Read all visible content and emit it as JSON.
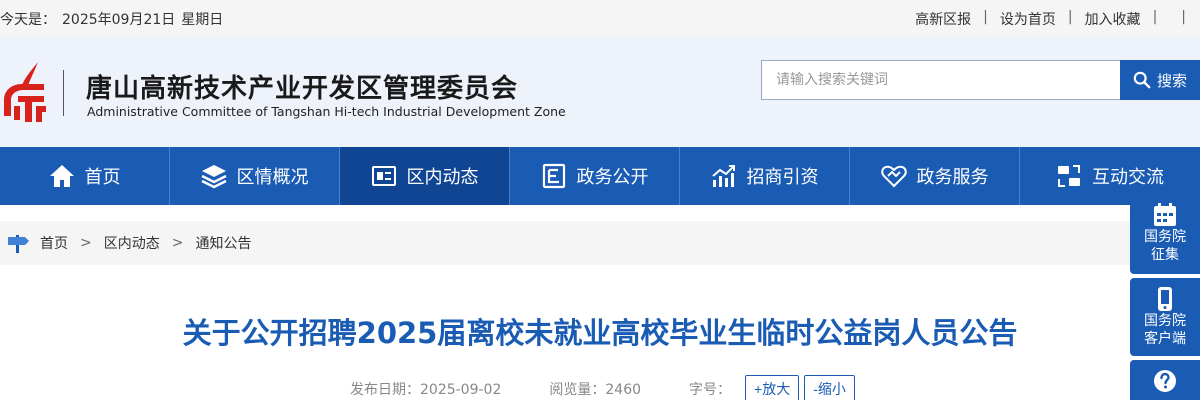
{
  "topbar": {
    "date_prefix": "今天是：",
    "date": "2025年09月21日",
    "weekday": "星期日",
    "links": [
      "高新区报",
      "设为首页",
      "加入收藏"
    ],
    "separators": [
      "|",
      "|",
      "|",
      "|"
    ]
  },
  "header": {
    "title": "唐山高新技术产业开发区管理委员会",
    "subtitle": "Administrative Committee of Tangshan Hi-tech Industrial Development Zone",
    "search_placeholder": "请输入搜索关键词",
    "search_button": "搜索"
  },
  "nav": {
    "items": [
      {
        "label": "首页",
        "icon": "home-icon"
      },
      {
        "label": "区情概况",
        "icon": "layers-icon"
      },
      {
        "label": "区内动态",
        "icon": "news-icon"
      },
      {
        "label": "政务公开",
        "icon": "document-icon"
      },
      {
        "label": "招商引资",
        "icon": "chart-icon"
      },
      {
        "label": "政务服务",
        "icon": "handshake-icon"
      },
      {
        "label": "互动交流",
        "icon": "exchange-icon"
      }
    ],
    "active": "区内动态"
  },
  "breadcrumb": {
    "items": [
      "首页",
      "区内动态",
      "通知公告"
    ],
    "separator": ">"
  },
  "article": {
    "title": "关于公开招聘2025届离校未就业高校毕业生临时公益岗人员公告",
    "publish_label": "发布日期：",
    "publish_date": "2025-09-02",
    "views_label": "阅览量：",
    "views": "2460",
    "fontsize_label": "字号：",
    "enlarge": "+放大",
    "shrink": "-缩小"
  },
  "side": {
    "items": [
      {
        "line1": "国务院",
        "line2": "征集",
        "icon": "calendar-icon"
      },
      {
        "line1": "国务院",
        "line2": "客户端",
        "icon": "phone-icon"
      },
      {
        "line1": "",
        "line2": "",
        "icon": "question-icon"
      }
    ]
  },
  "colors": {
    "primary": "#1a5bb3",
    "nav_active": "#0f4592",
    "logo_red": "#d7231c"
  }
}
